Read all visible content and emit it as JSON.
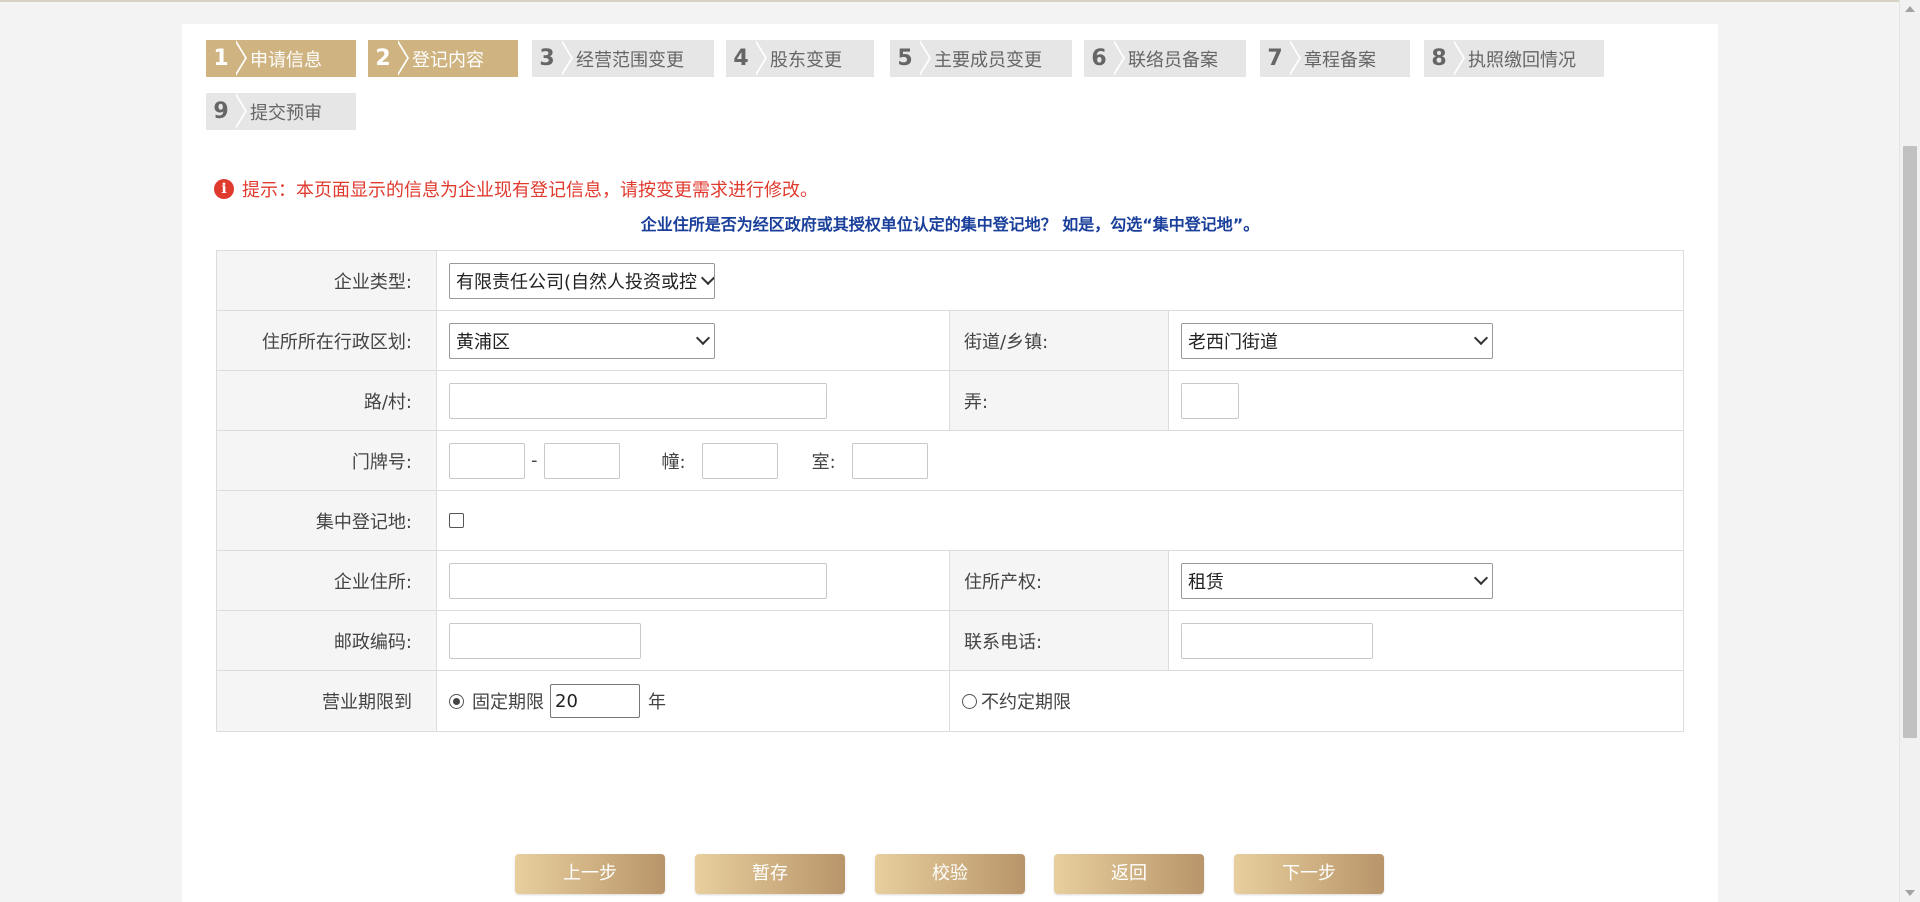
{
  "steps": [
    {
      "num": "1",
      "label": "申请信息",
      "active": true
    },
    {
      "num": "2",
      "label": "登记内容",
      "active": true
    },
    {
      "num": "3",
      "label": "经营范围变更",
      "active": false
    },
    {
      "num": "4",
      "label": "股东变更",
      "active": false
    },
    {
      "num": "5",
      "label": "主要成员变更",
      "active": false
    },
    {
      "num": "6",
      "label": "联络员备案",
      "active": false
    },
    {
      "num": "7",
      "label": "章程备案",
      "active": false
    },
    {
      "num": "8",
      "label": "执照缴回情况",
      "active": false
    },
    {
      "num": "9",
      "label": "提交预审",
      "active": false
    }
  ],
  "hint": {
    "icon": "info-icon",
    "text": "提示：本页面显示的信息为企业现有登记信息，请按变更需求进行修改。",
    "color": "#e03a2e"
  },
  "question": "企业住所是否为经区政府或其授权单位认定的集中登记地？ 如是，勾选“集中登记地”。",
  "form": {
    "company_type": {
      "label": "企业类型:",
      "value": "有限责任公司(自然人投资或控"
    },
    "district": {
      "label": "住所所在行政区划:",
      "value": "黄浦区"
    },
    "street": {
      "label": "街道/乡镇:",
      "value": "老西门街道"
    },
    "road": {
      "label": "路/村:",
      "value": ""
    },
    "lane": {
      "label": "弄:",
      "value": ""
    },
    "door": {
      "label": "门牌号:",
      "dash": "-",
      "building_label": "幢:",
      "room_label": "室:"
    },
    "central": {
      "label": "集中登记地:",
      "checked": false
    },
    "address": {
      "label": "企业住所:",
      "value": ""
    },
    "property": {
      "label": "住所产权:",
      "value": "租赁"
    },
    "postcode": {
      "label": "邮政编码:",
      "value": ""
    },
    "phone": {
      "label": "联系电话:",
      "value": ""
    },
    "term": {
      "label": "营业期限到",
      "fixed_label": "固定期限",
      "years": "20",
      "year_unit": "年",
      "indefinite_label": "不约定期限",
      "selected": "fixed"
    }
  },
  "buttons": {
    "prev": "上一步",
    "save": "暂存",
    "check": "校验",
    "back": "返回",
    "next": "下一步"
  },
  "colors": {
    "accent": "#cfb380",
    "question_blue": "#1a3f9a"
  }
}
